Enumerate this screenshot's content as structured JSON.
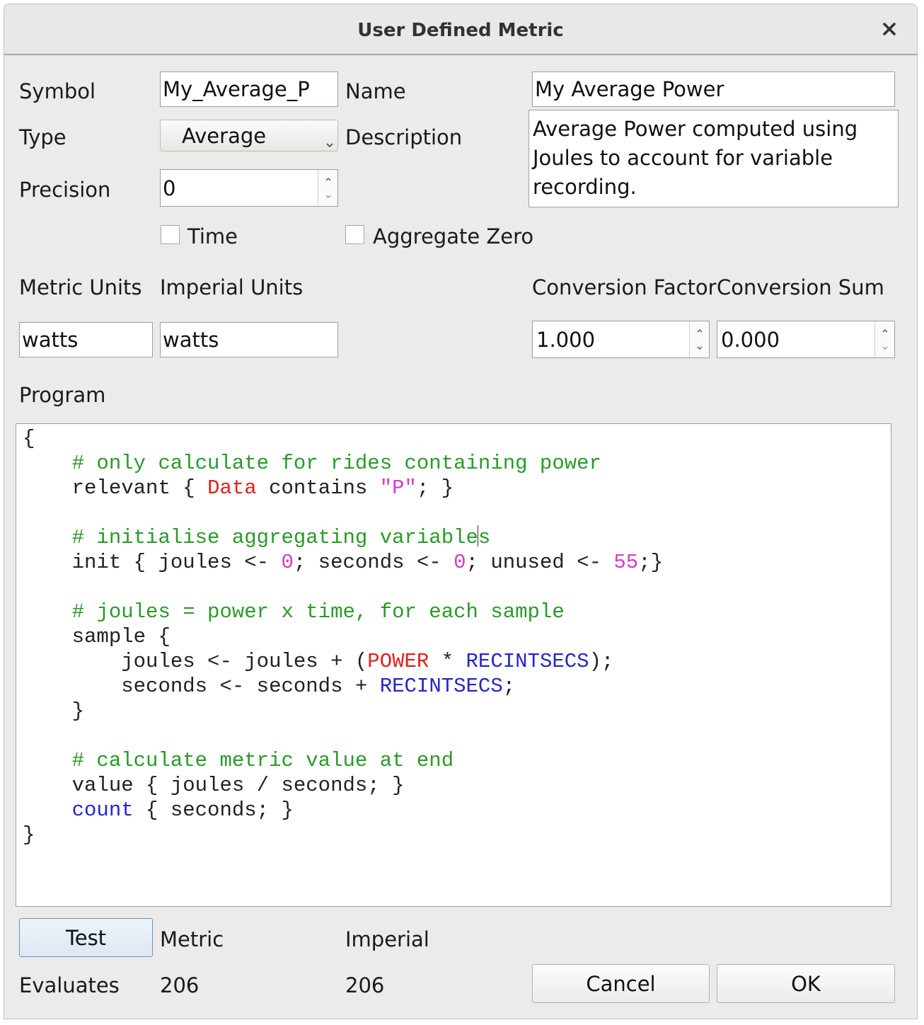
{
  "window": {
    "title": "User Defined Metric"
  },
  "form": {
    "symbol_label": "Symbol",
    "symbol_value": "My_Average_P",
    "name_label": "Name",
    "name_value": "My Average Power",
    "type_label": "Type",
    "type_value": "Average",
    "description_label": "Description",
    "description_value": "Average Power computed using Joules to account for variable recording.",
    "precision_label": "Precision",
    "precision_value": "0",
    "time_label": "Time",
    "aggregate_zero_label": "Aggregate Zero",
    "metric_units_label": "Metric Units",
    "metric_units_value": "watts",
    "imperial_units_label": "Imperial Units",
    "imperial_units_value": "watts",
    "conversion_factor_label": "Conversion Factor",
    "conversion_factor_value": "1.000",
    "conversion_sum_label": "Conversion Sum",
    "conversion_sum_value": "0.000",
    "program_label": "Program"
  },
  "program": {
    "open_brace": "{",
    "c1": "# only calculate for rides containing power",
    "l2a": "relevant { ",
    "l2kw": "Data",
    "l2b": " contains ",
    "l2str": "\"P\"",
    "l2c": "; }",
    "c2a": "# initialise aggregating variable",
    "c2b": "s",
    "l5a": "init { joules <- ",
    "l5n1": "0",
    "l5b": "; seconds <- ",
    "l5n2": "0",
    "l5c": "; unused <- ",
    "l5n3": "55",
    "l5d": ";}",
    "c3": "# joules = power x time, for each sample",
    "l8": "sample {",
    "l9a": "joules <- joules + (",
    "l9kw": "POWER",
    "l9b": " * ",
    "l9bu": "RECINTSECS",
    "l9c": ");",
    "l10a": "seconds <- seconds + ",
    "l10bu": "RECINTSECS",
    "l10b": ";",
    "l11": "}",
    "c4": "# calculate metric value at end",
    "l14": "value { joules / seconds; }",
    "l15kw": "count",
    "l15b": " { seconds; }",
    "close_brace": "}"
  },
  "results": {
    "test_button": "Test",
    "metric_label": "Metric",
    "imperial_label": "Imperial",
    "evaluates_label": "Evaluates",
    "metric_value": "206",
    "imperial_value": "206"
  },
  "buttons": {
    "cancel": "Cancel",
    "ok": "OK"
  },
  "colors": {
    "comment": "#2a9a2a",
    "keyword": "#e02020",
    "literal": "#d43ac8",
    "builtin": "#2626c8"
  }
}
